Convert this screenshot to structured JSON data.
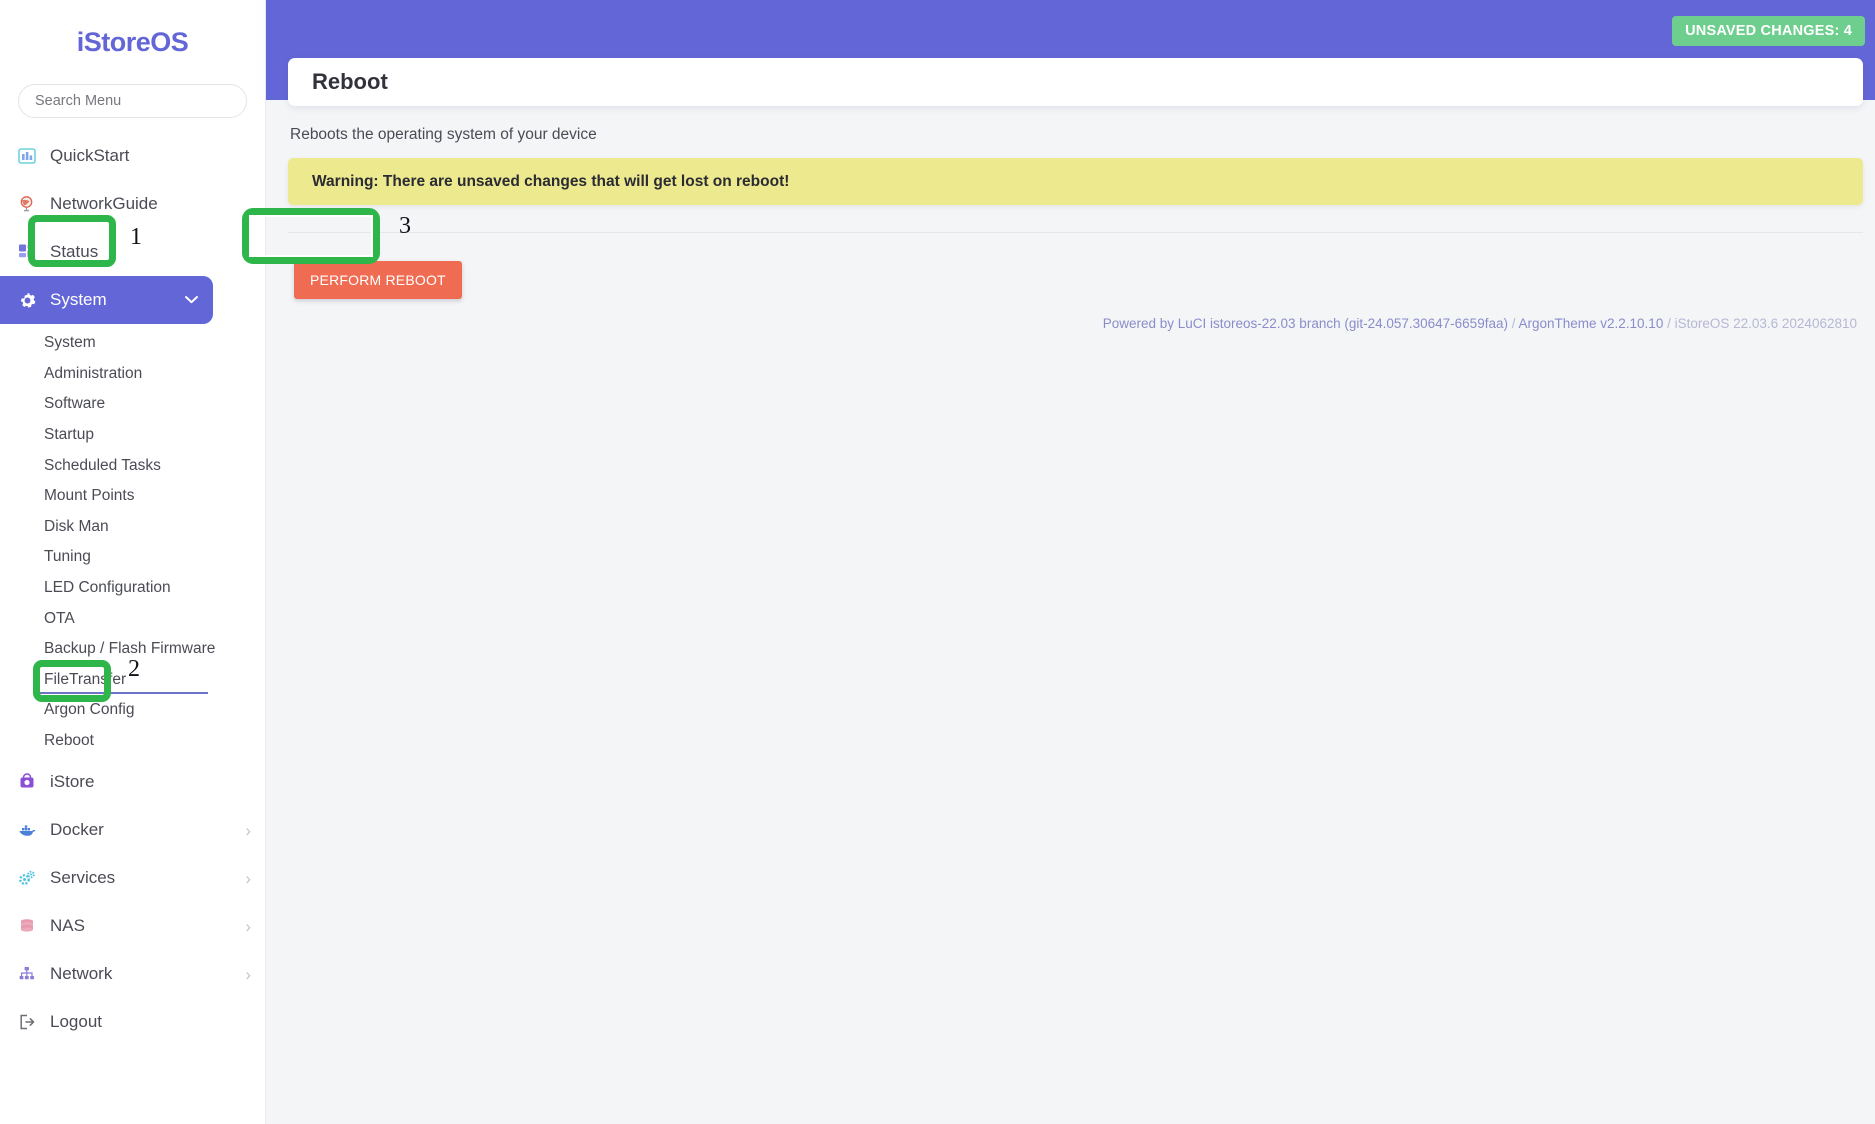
{
  "app": {
    "brand": "iStoreOS",
    "accent_color": "#6366d6",
    "badge_color": "#6ece8e",
    "warning_bg": "#ece98f",
    "danger_color": "#ef6c52",
    "highlight_color": "#2eb64a"
  },
  "search": {
    "placeholder": "Search Menu",
    "value": ""
  },
  "sidebar": {
    "items": [
      {
        "label": "QuickStart",
        "icon": "chart-bar-icon",
        "has_chevron": false
      },
      {
        "label": "NetworkGuide",
        "icon": "globe-icon",
        "has_chevron": false
      },
      {
        "label": "Status",
        "icon": "grid-squares-icon",
        "has_chevron": true,
        "chevron": "›"
      },
      {
        "label": "System",
        "icon": "gear-icon",
        "has_chevron": true,
        "chevron": "⌄",
        "active": true
      }
    ],
    "system_submenu": [
      {
        "label": "System"
      },
      {
        "label": "Administration"
      },
      {
        "label": "Software"
      },
      {
        "label": "Startup"
      },
      {
        "label": "Scheduled Tasks"
      },
      {
        "label": "Mount Points"
      },
      {
        "label": "Disk Man"
      },
      {
        "label": "Tuning"
      },
      {
        "label": "LED Configuration"
      },
      {
        "label": "OTA"
      },
      {
        "label": "Backup / Flash Firmware"
      },
      {
        "label": "FileTransfer"
      },
      {
        "label": "Argon Config"
      },
      {
        "label": "Reboot",
        "selected": true
      }
    ],
    "items_bottom": [
      {
        "label": "iStore",
        "icon": "shopping-bag-icon",
        "has_chevron": false
      },
      {
        "label": "Docker",
        "icon": "docker-whale-icon",
        "has_chevron": true,
        "chevron": "›"
      },
      {
        "label": "Services",
        "icon": "cogs-icon",
        "has_chevron": true,
        "chevron": "›"
      },
      {
        "label": "NAS",
        "icon": "database-icon",
        "has_chevron": true,
        "chevron": "›"
      },
      {
        "label": "Network",
        "icon": "sitemap-icon",
        "has_chevron": true,
        "chevron": "›"
      },
      {
        "label": "Logout",
        "icon": "logout-icon",
        "has_chevron": false
      }
    ]
  },
  "topbar": {
    "unsaved_changes": "UNSAVED CHANGES: 4"
  },
  "page": {
    "title": "Reboot",
    "description": "Reboots the operating system of your device",
    "warning": "Warning: There are unsaved changes that will get lost on reboot!",
    "reboot_button": "PERFORM REBOOT"
  },
  "footer": {
    "powered_by": "Powered by LuCI istoreos-22.03 branch (git-24.057.30647-6659faa)",
    "sep1": " / ",
    "theme": "ArgonTheme v2.2.10.10",
    "sep2": " / ",
    "version": "iStoreOS 22.03.6 2024062810"
  },
  "annotations": {
    "step1": "1",
    "step2": "2",
    "step3": "3"
  }
}
